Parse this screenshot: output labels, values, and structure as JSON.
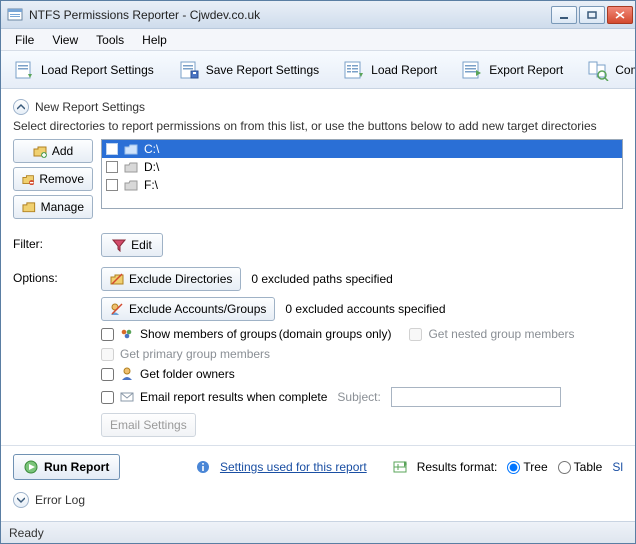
{
  "window": {
    "title": "NTFS Permissions Reporter - Cjwdev.co.uk"
  },
  "menu": {
    "file": "File",
    "view": "View",
    "tools": "Tools",
    "help": "Help"
  },
  "toolbar": {
    "load_settings": "Load Report Settings",
    "save_settings": "Save Report Settings",
    "load_report": "Load Report",
    "export_report": "Export Report",
    "compare_report": "Compare Repo"
  },
  "section": {
    "title": "New Report Settings",
    "subtext": "Select directories to report permissions on from this list, or use the buttons below to add new target directories"
  },
  "buttons": {
    "add": "Add",
    "remove": "Remove",
    "manage": "Manage",
    "edit": "Edit",
    "exclude_dirs": "Exclude Directories",
    "exclude_accounts": "Exclude Accounts/Groups",
    "email_settings": "Email Settings",
    "run_report": "Run Report"
  },
  "directories": [
    {
      "label": "C:\\",
      "checked": false,
      "selected": true
    },
    {
      "label": "D:\\",
      "checked": false,
      "selected": false
    },
    {
      "label": "F:\\",
      "checked": false,
      "selected": false
    }
  ],
  "labels": {
    "filter": "Filter:",
    "options": "Options:"
  },
  "options": {
    "excluded_paths_text": "0 excluded paths specified",
    "excluded_accounts_text": "0 excluded accounts specified",
    "show_members": "Show members of groups",
    "show_members_suffix": "(domain groups only)",
    "get_nested": "Get nested group members",
    "get_primary": "Get primary group members",
    "get_folder_owners": "Get folder owners",
    "email_results": "Email report results when complete",
    "subject_label": "Subject:",
    "subject_value": ""
  },
  "bottom": {
    "settings_link": "Settings used for this report",
    "results_format_label": "Results format:",
    "tree": "Tree",
    "table": "Table",
    "sl": "Sl"
  },
  "errorlog": {
    "title": "Error Log"
  },
  "status": {
    "text": "Ready"
  }
}
